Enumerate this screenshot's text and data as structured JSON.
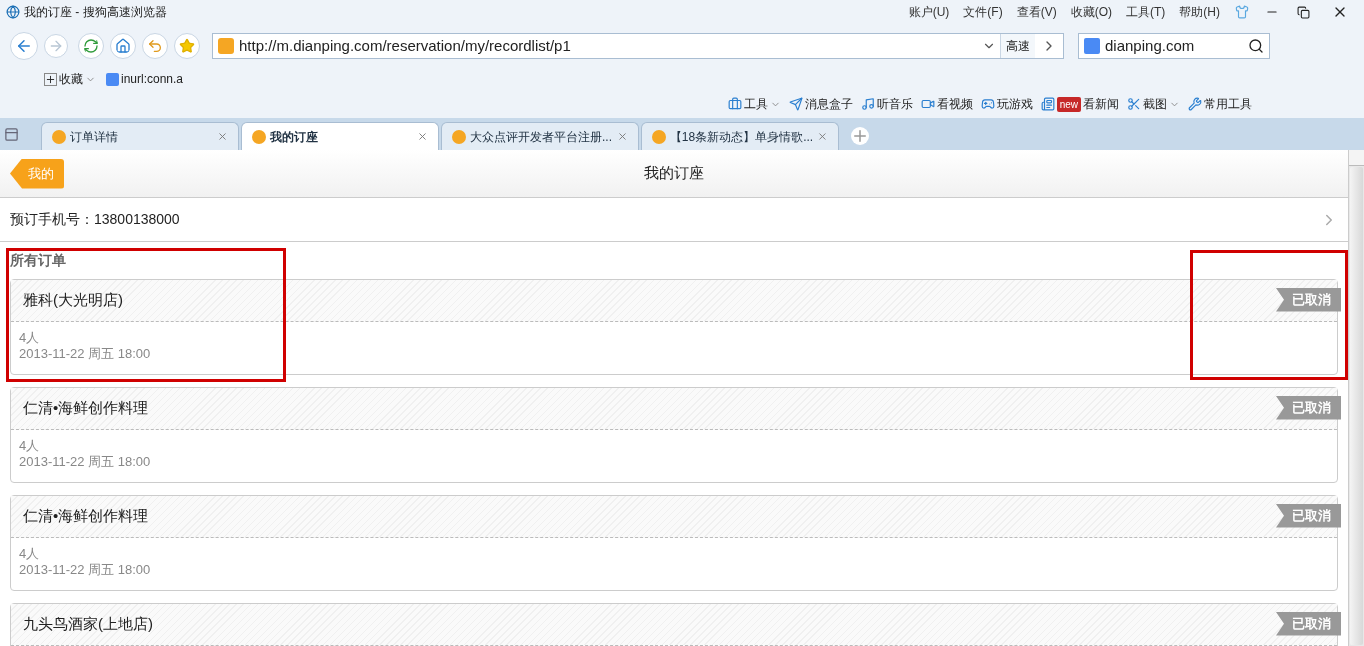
{
  "window": {
    "title": "我的订座 - 搜狗高速浏览器"
  },
  "menu": [
    "账户(U)",
    "文件(F)",
    "查看(V)",
    "收藏(O)",
    "工具(T)",
    "帮助(H)"
  ],
  "address": {
    "url": "http://m.dianping.com/reservation/my/recordlist/p1",
    "speed": "高速"
  },
  "search": {
    "value": "dianping.com"
  },
  "bookmarks": [
    {
      "label": "收藏",
      "kind": "menu"
    },
    {
      "label": "inurl:conn.a",
      "kind": "link"
    }
  ],
  "toolbar": [
    {
      "label": "工具",
      "kind": "menu"
    },
    {
      "label": "消息盒子",
      "kind": "plain"
    },
    {
      "label": "听音乐",
      "kind": "plain"
    },
    {
      "label": "看视频",
      "kind": "plain"
    },
    {
      "label": "玩游戏",
      "kind": "plain"
    },
    {
      "label": "看新闻",
      "kind": "news",
      "badge": "new"
    },
    {
      "label": "截图",
      "kind": "menu"
    },
    {
      "label": "常用工具",
      "kind": "plain"
    }
  ],
  "tabs": [
    {
      "label": "订单详情",
      "selected": false
    },
    {
      "label": "我的订座",
      "selected": true
    },
    {
      "label": "大众点评开发者平台注册...",
      "selected": false
    },
    {
      "label": "【18条新动态】单身情歌...",
      "selected": false
    }
  ],
  "page": {
    "back": "我的",
    "title": "我的订座",
    "phone_label": "预订手机号：",
    "phone": "13800138000",
    "section": "所有订单",
    "orders": [
      {
        "name": "雅科(大光明店)",
        "people": "4人",
        "time": "2013-11-22 周五 18:00",
        "status": "已取消"
      },
      {
        "name": "仁清•海鲜创作料理",
        "people": "4人",
        "time": "2013-11-22 周五 18:00",
        "status": "已取消"
      },
      {
        "name": "仁清•海鲜创作料理",
        "people": "4人",
        "time": "2013-11-22 周五 18:00",
        "status": "已取消"
      },
      {
        "name": "九头鸟酒家(上地店)",
        "status": "已取消"
      }
    ]
  }
}
